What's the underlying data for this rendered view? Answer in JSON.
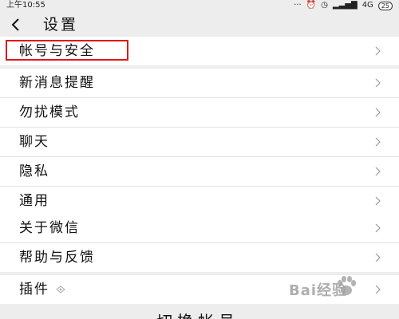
{
  "status_bar": {
    "time": "上午10:55",
    "icons": [
      "more-icon",
      "alarm-icon",
      "clock-icon",
      "signal-icon"
    ],
    "network": "4G",
    "battery": "25"
  },
  "nav": {
    "title": "设置",
    "back_icon": "back-arrow-icon"
  },
  "groups": [
    {
      "items": [
        {
          "label": "帐号与安全",
          "highlighted": true
        }
      ]
    },
    {
      "items": [
        {
          "label": "新消息提醒"
        },
        {
          "label": "勿扰模式"
        },
        {
          "label": "聊天"
        },
        {
          "label": "隐私"
        },
        {
          "label": "通用"
        }
      ]
    },
    {
      "items": [
        {
          "label": "关于微信"
        },
        {
          "label": "帮助与反馈"
        }
      ]
    },
    {
      "items": [
        {
          "label": "插件",
          "icon": "plugin-shield-icon"
        }
      ]
    }
  ],
  "chevron_icon": "chevron-right-icon",
  "watermark": {
    "text": "Bai经验"
  },
  "bottom_partial_text": "切换帐号",
  "colors": {
    "background": "#ededed",
    "row_background": "#ffffff",
    "highlight_border": "#e01919"
  }
}
